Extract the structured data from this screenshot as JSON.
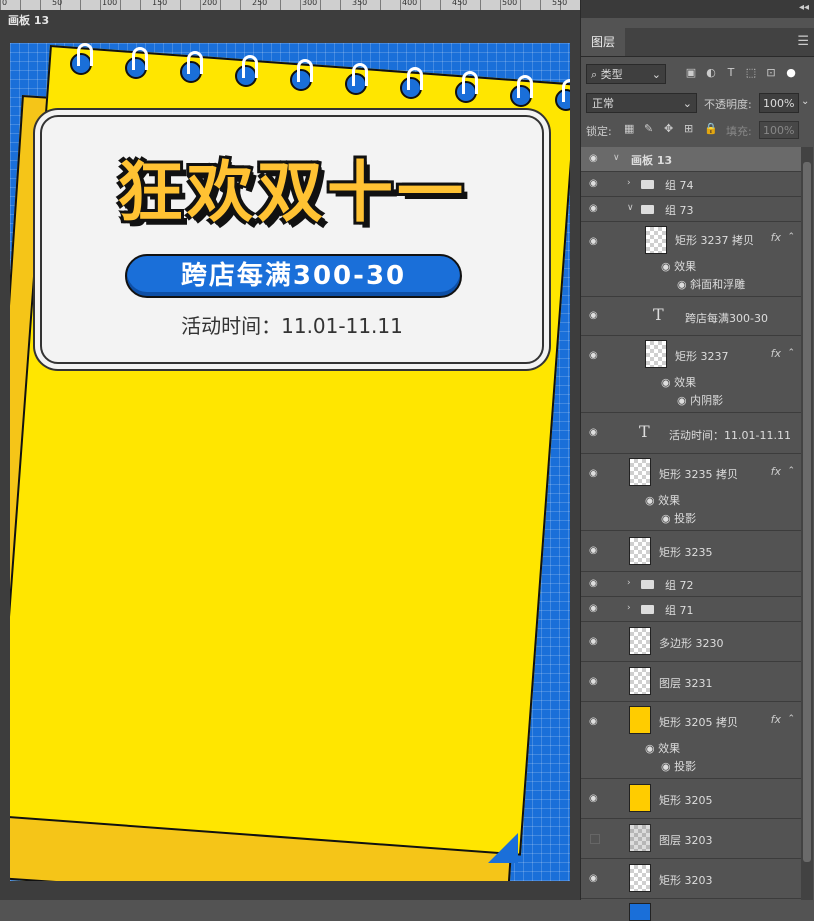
{
  "ruler": {
    "labels": [
      "0",
      "50",
      "100",
      "150",
      "200",
      "250",
      "300",
      "350",
      "400",
      "450",
      "500",
      "550"
    ]
  },
  "artboard": {
    "label": "画板 13"
  },
  "poster": {
    "title": "狂欢双十一",
    "subtitle": "跨店每满300-30",
    "date": "活动时间：11.01-11.11"
  },
  "panel": {
    "tab": "图层",
    "filter": "类型",
    "blend_mode": "正常",
    "opacity_label": "不透明度:",
    "opacity_value": "100%",
    "lock_label": "锁定:",
    "fill_label": "填充:",
    "fill_value": "100%"
  },
  "layers": [
    {
      "name": "画板 13",
      "kind": "artboard"
    },
    {
      "name": "组 74",
      "kind": "group"
    },
    {
      "name": "组 73",
      "kind": "group-open"
    },
    {
      "name": "矩形 3237 拷贝",
      "kind": "shape",
      "fx": true,
      "effects": [
        "效果",
        "斜面和浮雕"
      ]
    },
    {
      "name": "跨店每满300-30",
      "kind": "text"
    },
    {
      "name": "矩形 3237",
      "kind": "shape",
      "fx": true,
      "effects": [
        "效果",
        "内阴影"
      ]
    },
    {
      "name": "活动时间：11.01-11.11",
      "kind": "text"
    },
    {
      "name": "矩形 3235 拷贝",
      "kind": "shape",
      "fx": true,
      "effects": [
        "效果",
        "投影"
      ]
    },
    {
      "name": "矩形 3235",
      "kind": "shape"
    },
    {
      "name": "组 72",
      "kind": "group"
    },
    {
      "name": "组 71",
      "kind": "group"
    },
    {
      "name": "多边形 3230",
      "kind": "shape"
    },
    {
      "name": "图层 3231",
      "kind": "pixel"
    },
    {
      "name": "矩形 3205 拷贝",
      "kind": "shape-yellow",
      "fx": true,
      "effects": [
        "效果",
        "投影"
      ]
    },
    {
      "name": "矩形 3205",
      "kind": "shape-yellow"
    },
    {
      "name": "图层 3203",
      "kind": "pixel",
      "hidden": true
    },
    {
      "name": "矩形 3203",
      "kind": "shape"
    }
  ],
  "icons": {
    "eye": "eye-icon",
    "folder": "folder-icon",
    "text": "text-layer-icon",
    "fx": "fx-icon"
  }
}
